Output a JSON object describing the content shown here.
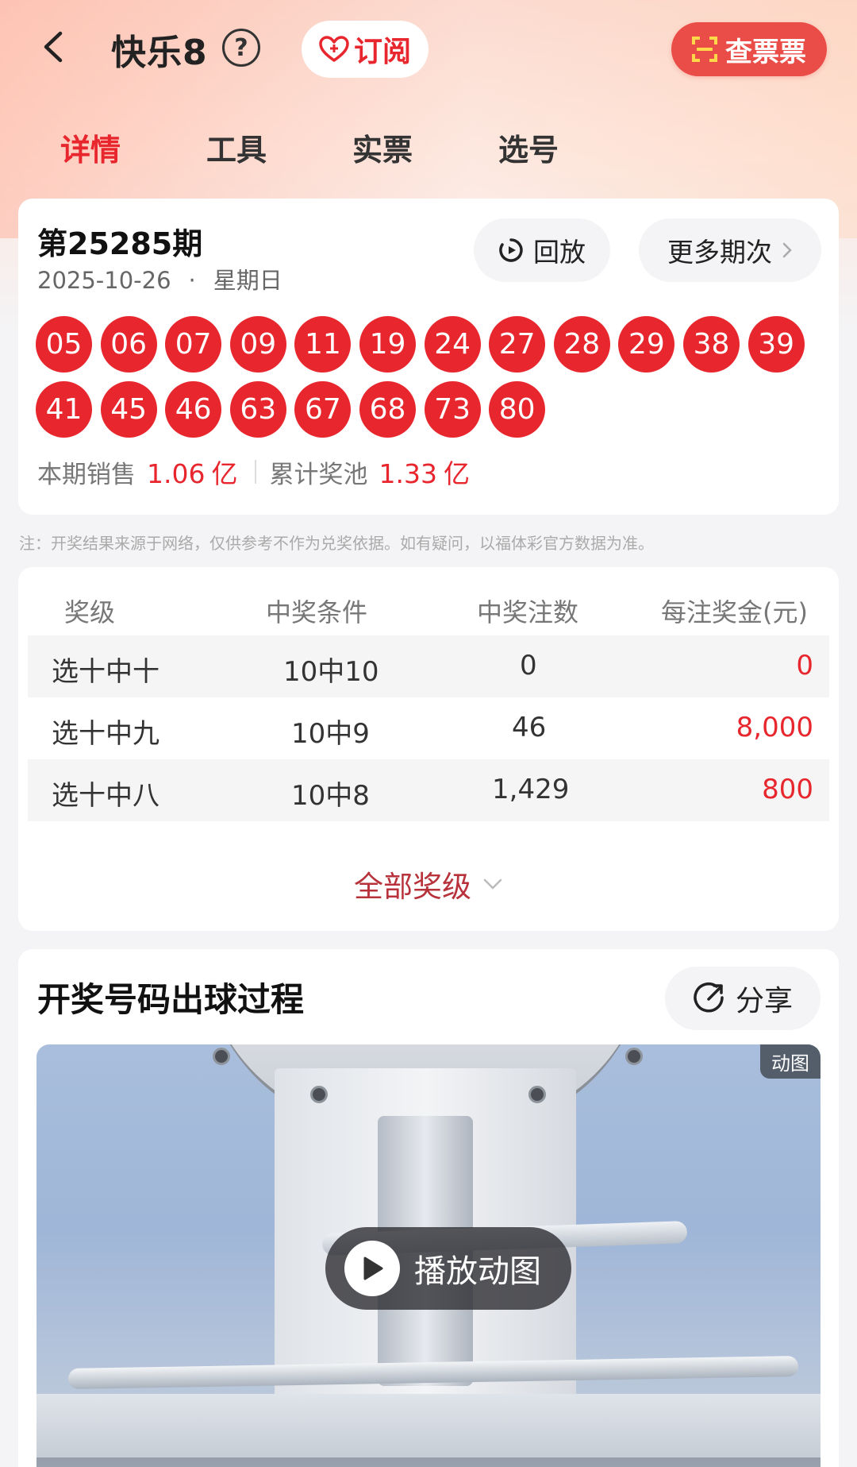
{
  "header": {
    "title": "快乐8",
    "subscribe_label": "订阅",
    "check_ticket_label": "查票票"
  },
  "tabs": [
    {
      "label": "详情",
      "active": true
    },
    {
      "label": "工具",
      "active": false
    },
    {
      "label": "实票",
      "active": false
    },
    {
      "label": "选号",
      "active": false
    }
  ],
  "draw": {
    "issue": "第25285期",
    "date": "2025-10-26",
    "dot": "·",
    "weekday": "星期日",
    "replay_label": "回放",
    "more_label": "更多期次",
    "numbers": [
      "05",
      "06",
      "07",
      "09",
      "11",
      "19",
      "24",
      "27",
      "28",
      "29",
      "38",
      "39",
      "41",
      "45",
      "46",
      "63",
      "67",
      "68",
      "73",
      "80"
    ],
    "sales_label": "本期销售",
    "sales_value": "1.06",
    "sales_unit": "亿",
    "pool_label": "累计奖池",
    "pool_value": "1.33",
    "pool_unit": "亿"
  },
  "note": "注：开奖结果来源于网络，仅供参考不作为兑奖依据。如有疑问，以福体彩官方数据为准。",
  "prize_table": {
    "headers": [
      "奖级",
      "中奖条件",
      "中奖注数",
      "每注奖金(元)"
    ],
    "rows": [
      {
        "level": "选十中十",
        "condition": "10中10",
        "count": "0",
        "prize": "0"
      },
      {
        "level": "选十中九",
        "condition": "10中9",
        "count": "46",
        "prize": "8,000"
      },
      {
        "level": "选十中八",
        "condition": "10中8",
        "count": "1,429",
        "prize": "800"
      }
    ],
    "all_levels_label": "全部奖级"
  },
  "video_section": {
    "title": "开奖号码出球过程",
    "share_label": "分享",
    "badge": "动图",
    "play_label": "播放动图"
  },
  "colors": {
    "accent_red": "#e8262d",
    "ball_red": "#e8262d",
    "check_button_bg": "#ea4d48"
  }
}
